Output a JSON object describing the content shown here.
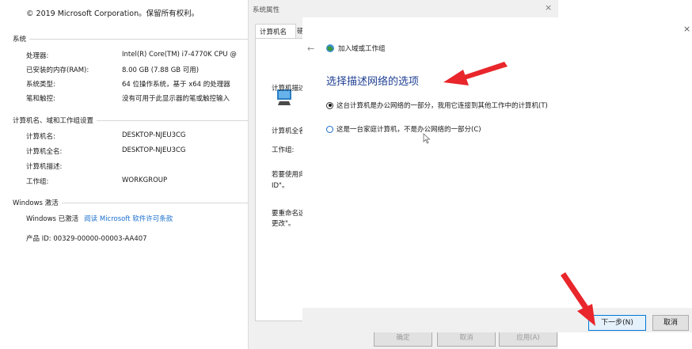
{
  "system": {
    "copyright": "© 2019 Microsoft Corporation。保留所有权利。",
    "section_system": "系统",
    "processor_label": "处理器:",
    "processor_value": "Intel(R) Core(TM) i7-4770K CPU @",
    "ram_label": "已安装的内存(RAM):",
    "ram_value": "8.00 GB (7.88 GB 可用)",
    "systype_label": "系统类型:",
    "systype_value": "64 位操作系统，基于 x64 的处理器",
    "pen_label": "笔和触控:",
    "pen_value": "没有可用于此显示器的笔或触控输入",
    "section_computer": "计算机名、域和工作组设置",
    "name_label": "计算机名:",
    "name_value": "DESKTOP-NJEU3CG",
    "fullname_label": "计算机全名:",
    "fullname_value": "DESKTOP-NJEU3CG",
    "desc_label": "计算机描述:",
    "workgroup_label": "工作组:",
    "workgroup_value": "WORKGROUP",
    "section_activation": "Windows 激活",
    "activated_text": "Windows 已激活",
    "license_link": "阅读 Microsoft 软件许可条款",
    "product_id": "产品 ID: 00329-00000-00003-AA407"
  },
  "dialog": {
    "title": "系统属性",
    "close_glyph": "×",
    "tab_active": "计算机名",
    "tab_partial": "硬",
    "desc_label": "计算机描述",
    "fullname_label": "计算机全名",
    "workgroup_label": "工作组:",
    "domain_hint_1": "若要使用向",
    "domain_hint_2": "ID\"。",
    "rename_hint_1": "要重命名这",
    "rename_hint_2": "更改\"。",
    "ok_label": "确定",
    "cancel_label": "取消",
    "apply_label": "应用(A)"
  },
  "wizard": {
    "close_glyph": "×",
    "back_glyph": "←",
    "title": "加入域或工作组",
    "heading": "选择描述网络的选项",
    "option_office": "这台计算机是办公网络的一部分，我用它连接到其他工作中的计算机(T)",
    "option_home": "这是一台家庭计算机，不是办公网络的一部分(C)",
    "next_label": "下一步(N)",
    "cancel_label": "取消",
    "selected_option": "office"
  },
  "colors": {
    "heading_blue": "#1f3f93",
    "link_blue": "#1a6fce",
    "annotation_red": "#e8262b",
    "focus_border": "#0078d7"
  }
}
